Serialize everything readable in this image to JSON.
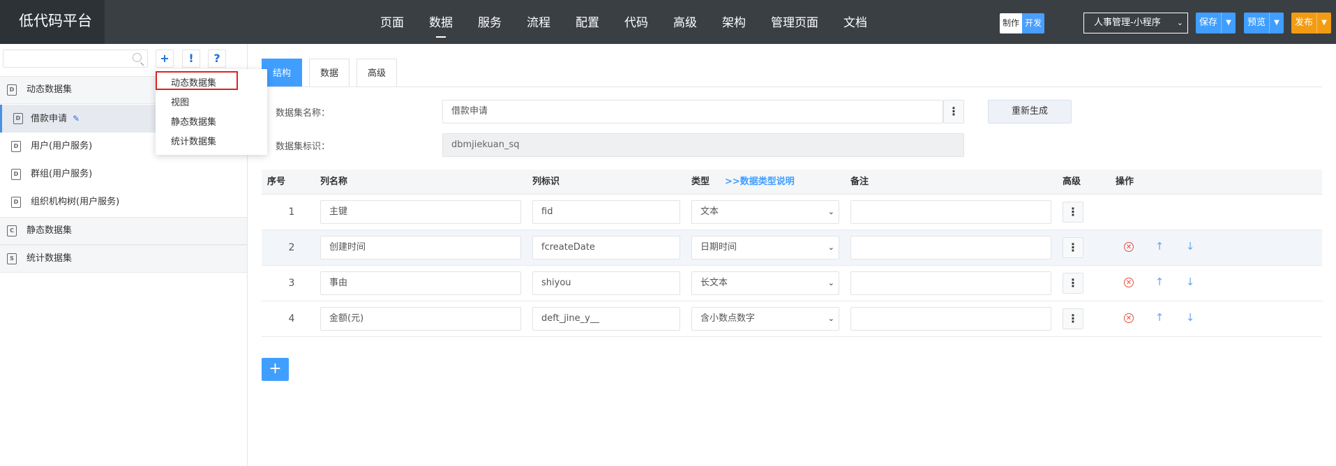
{
  "header": {
    "logo": "低代码平台",
    "nav": [
      "页面",
      "数据",
      "服务",
      "流程",
      "配置",
      "代码",
      "高级",
      "架构",
      "管理页面",
      "文档"
    ],
    "active_nav": "数据",
    "mode_make": "制作",
    "mode_dev": "开发",
    "app_select": "人事管理-小程序",
    "save_label": "保存",
    "preview_label": "预览",
    "publish_label": "发布"
  },
  "sidebar": {
    "search_value": "",
    "add_label": "+",
    "info_label": "!",
    "help_label": "?",
    "groups": [
      {
        "label": "动态数据集",
        "icon": "D"
      },
      {
        "label": "静态数据集",
        "icon": "C"
      },
      {
        "label": "统计数据集",
        "icon": "S"
      }
    ],
    "items": [
      {
        "label": "借款申请"
      },
      {
        "label": "用户(用户服务)"
      },
      {
        "label": "群组(用户服务)"
      },
      {
        "label": "组织机构树(用户服务)"
      }
    ]
  },
  "dropdown": {
    "items": [
      "动态数据集",
      "视图",
      "静态数据集",
      "统计数据集"
    ]
  },
  "tabs": [
    "结构",
    "数据",
    "高级"
  ],
  "form": {
    "name_label": "数据集名称：",
    "name_value": "借款申请",
    "id_label": "数据集标识：",
    "id_value": "dbmjiekuan_sq",
    "regen_label": "重新生成"
  },
  "table": {
    "headers": {
      "idx": "序号",
      "name": "列名称",
      "id": "列标识",
      "type": "类型",
      "type_link": ">>数据类型说明",
      "remark": "备注",
      "advanced": "高级",
      "op": "操作"
    },
    "rows": [
      {
        "idx": "1",
        "name": "主键",
        "id": "fid",
        "type": "文本",
        "remark": ""
      },
      {
        "idx": "2",
        "name": "创建时间",
        "id": "fcreateDate",
        "type": "日期时间",
        "remark": ""
      },
      {
        "idx": "3",
        "name": "事由",
        "id": "shiyou",
        "type": "长文本",
        "remark": ""
      },
      {
        "idx": "4",
        "name": "金额(元)",
        "id": "deft_jine_y__",
        "type": "含小数点数字",
        "remark": ""
      }
    ],
    "add_row_label": "+"
  },
  "colors": {
    "header_bg": "#3a3f44",
    "accent": "#409eff",
    "publish": "#f39c12",
    "delete": "#e74c3c"
  }
}
